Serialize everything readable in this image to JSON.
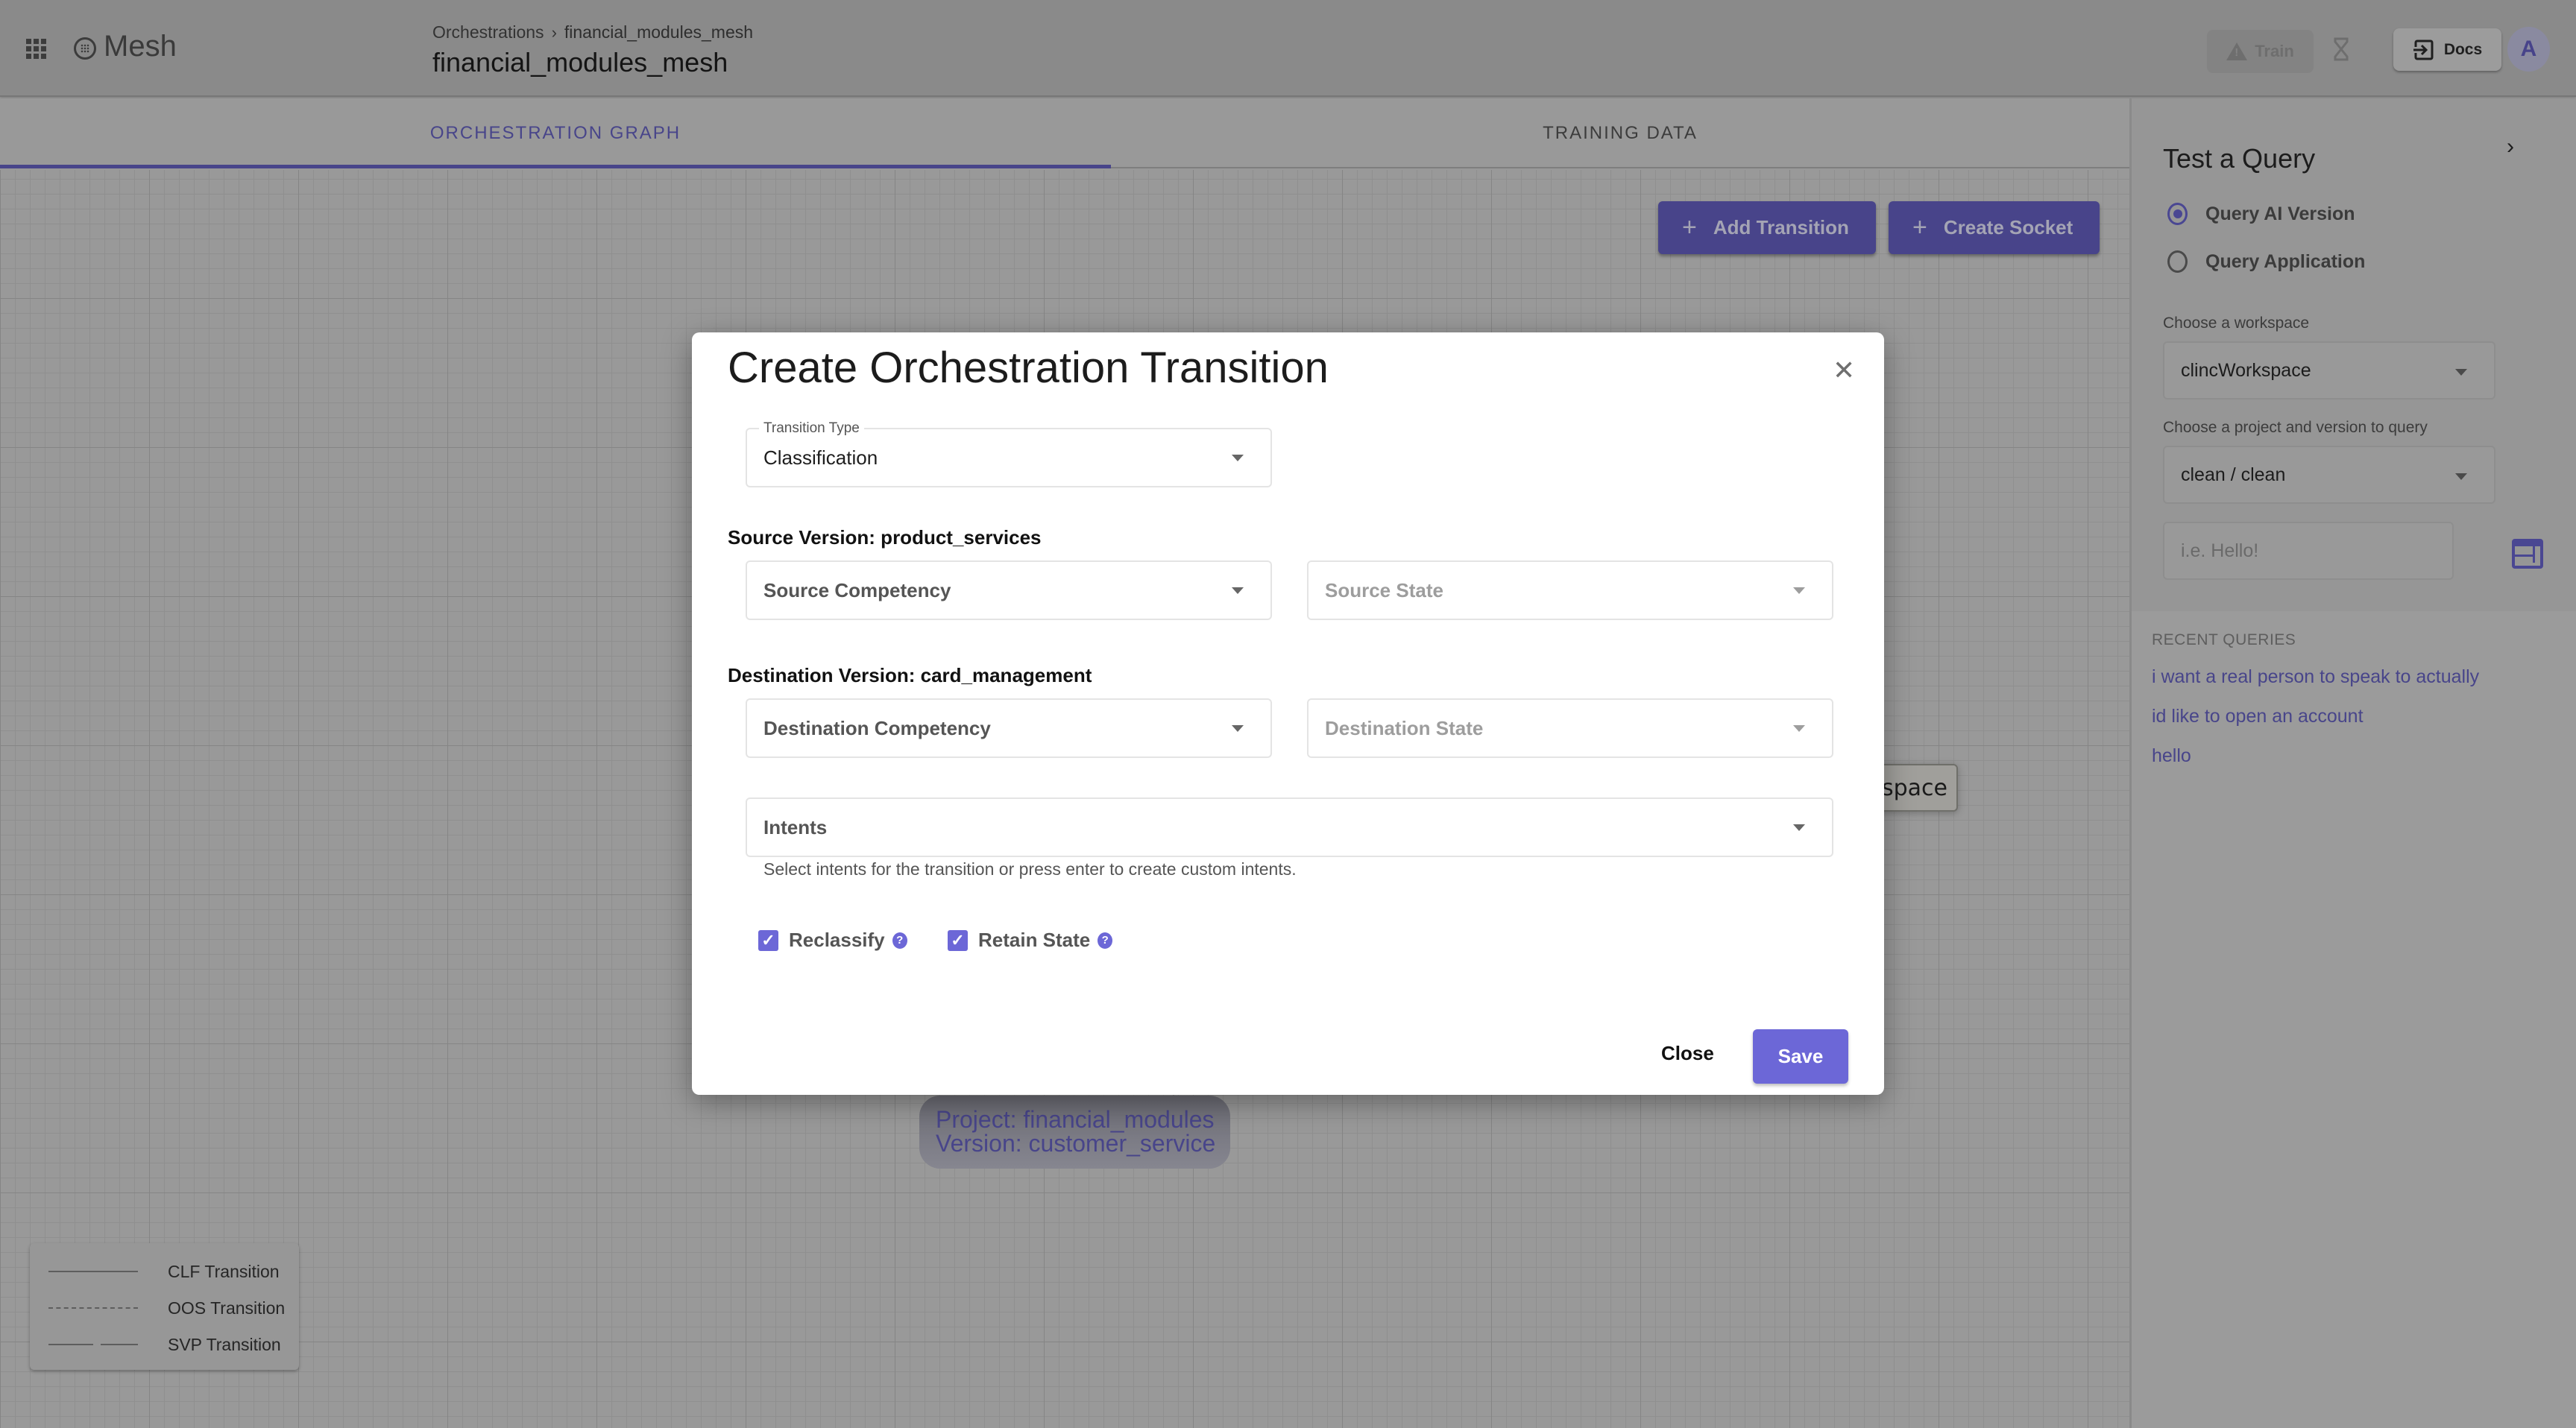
{
  "header": {
    "app_name": "Mesh",
    "breadcrumb": [
      "Orchestrations",
      "financial_modules_mesh"
    ],
    "title": "financial_modules_mesh",
    "train_label": "Train",
    "docs_label": "Docs",
    "avatar_initial": "A"
  },
  "tabs": [
    {
      "label": "ORCHESTRATION GRAPH",
      "active": true
    },
    {
      "label": "TRAINING DATA",
      "active": false
    }
  ],
  "canvas": {
    "add_transition_label": "Add Transition",
    "create_socket_label": "Create Socket",
    "nodes": {
      "workspace_partial": "kspace",
      "project_line": "Project: financial_modules",
      "version_line": "Version: customer_service"
    },
    "legend": [
      {
        "style": "solid",
        "label": "CLF Transition"
      },
      {
        "style": "dashed",
        "label": "OOS Transition"
      },
      {
        "style": "long-dash",
        "label": "SVP Transition"
      }
    ]
  },
  "panel": {
    "title": "Test a Query",
    "radio_options": [
      {
        "label": "Query AI Version",
        "selected": true
      },
      {
        "label": "Query Application",
        "selected": false
      }
    ],
    "workspace_label": "Choose a workspace",
    "workspace_value": "clincWorkspace",
    "project_label": "Choose a project and version to query",
    "project_value": "clean / clean",
    "query_placeholder": "i.e. Hello!",
    "recent_title": "RECENT QUERIES",
    "recent_queries": [
      "i want a real person to speak to actually",
      "id like to open an account",
      "hello"
    ]
  },
  "modal": {
    "title": "Create Orchestration Transition",
    "transition_type_label": "Transition Type",
    "transition_type_value": "Classification",
    "source_version": "Source Version: product_services",
    "source_competency_placeholder": "Source Competency",
    "source_state_placeholder": "Source State",
    "destination_version": "Destination Version: card_management",
    "destination_competency_placeholder": "Destination Competency",
    "destination_state_placeholder": "Destination State",
    "intents_placeholder": "Intents",
    "intents_helper": "Select intents for the transition or press enter to create custom intents.",
    "reclassify_label": "Reclassify",
    "reclassify_checked": true,
    "retain_state_label": "Retain State",
    "retain_state_checked": true,
    "close_label": "Close",
    "save_label": "Save"
  },
  "colors": {
    "accent": "#6c67d7",
    "accent_dimmed": "#48458a",
    "overlay_gray": "#999999"
  }
}
